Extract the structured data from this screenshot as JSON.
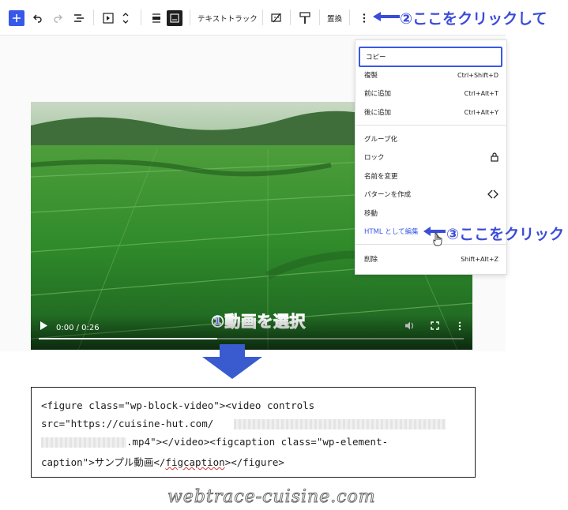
{
  "toolbar": {
    "text_track_label": "テキストトラック",
    "replace_label": "置換",
    "icons": [
      "plus-icon",
      "undo-icon",
      "redo-icon",
      "list-view-icon",
      "video-block-icon",
      "move-arrows-icon",
      "align-icon",
      "full-width-icon",
      "text-track-icon",
      "caption-icon",
      "paint-roller-icon",
      "options-icon"
    ]
  },
  "video": {
    "time_display": "0:00 / 0:26",
    "progress": 0.42
  },
  "menu": {
    "copy": "コピー",
    "duplicate": "複製",
    "duplicate_shortcut": "Ctrl+Shift+D",
    "insert_before": "前に追加",
    "insert_before_shortcut": "Ctrl+Alt+T",
    "insert_after": "後に追加",
    "insert_after_shortcut": "Ctrl+Alt+Y",
    "group": "グループ化",
    "lock": "ロック",
    "rename": "名前を変更",
    "create_pattern": "パターンを作成",
    "move": "移動",
    "edit_as_html": "HTML として編集",
    "delete": "削除",
    "delete_shortcut": "Shift+Alt+Z"
  },
  "annotations": {
    "step1": "①動画を選択",
    "step2": "②ここをクリックして",
    "step3": "③ここをクリック"
  },
  "code": {
    "line1": "<figure class=\"wp-block-video\"><video controls",
    "line2": "src=\"https://cuisine-hut.com/",
    "line3": ".mp4\"></video><figcaption class=\"wp-element-",
    "line4_pre": "caption\">サンプル動画</",
    "line4_squiggle": "figcaption",
    "line4_post": "></figure>"
  },
  "watermark": "webtrace-cuisine.com",
  "colors": {
    "accent": "#3858e9",
    "annotation": "#3b4cd8",
    "field_green": "#2e7d32"
  }
}
